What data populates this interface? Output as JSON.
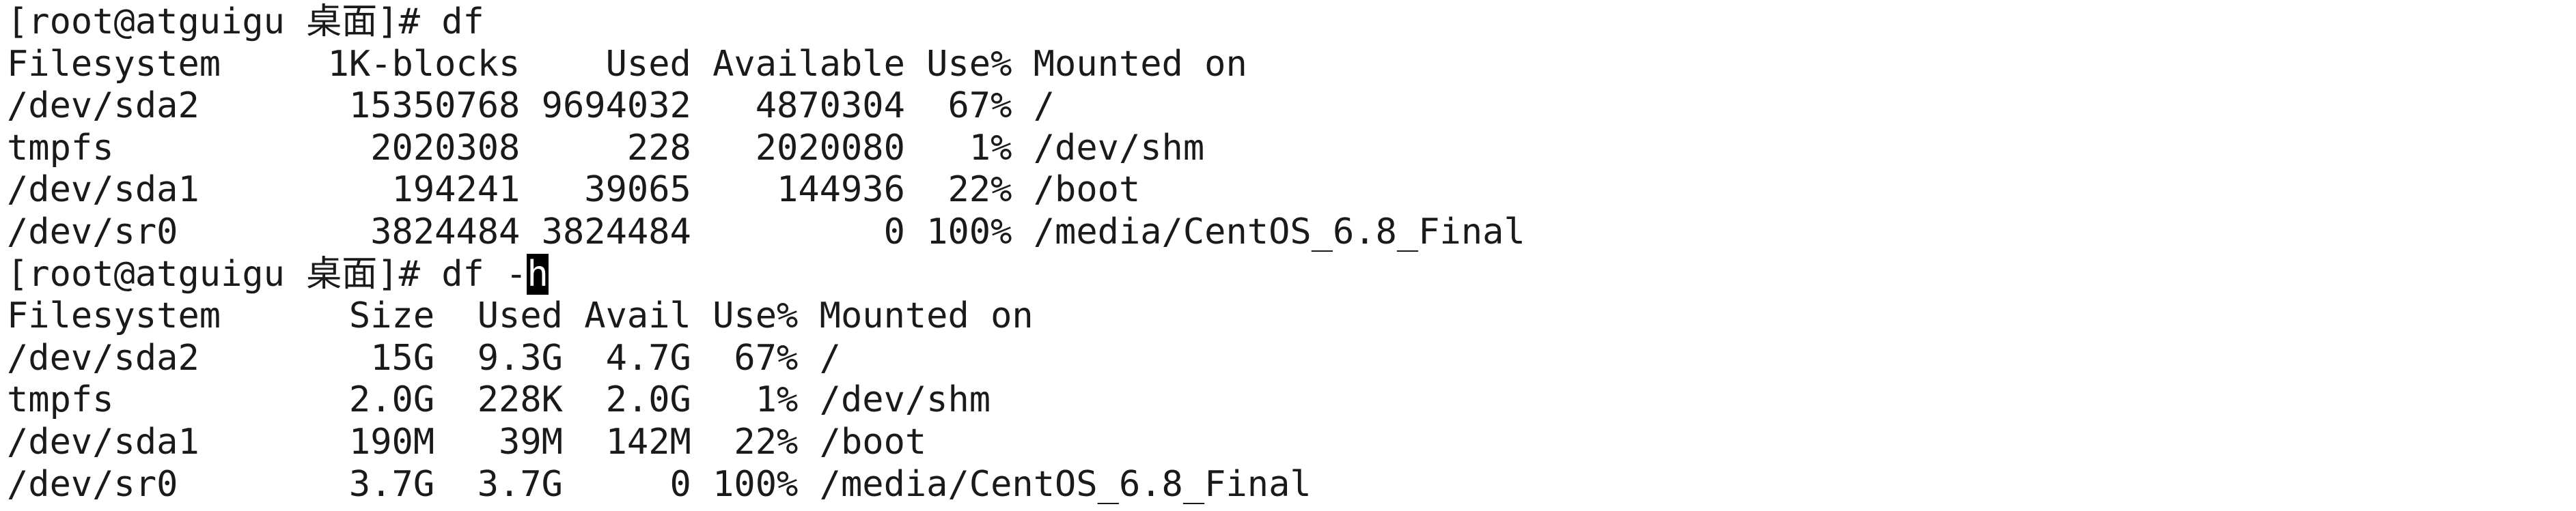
{
  "terminal": {
    "lines": [
      {
        "text": "[root@atguigu 桌面]# df"
      },
      {
        "text": "Filesystem     1K-blocks    Used Available Use% Mounted on"
      },
      {
        "text": "/dev/sda2       15350768 9694032   4870304  67% /"
      },
      {
        "text": "tmpfs            2020308     228   2020080   1% /dev/shm"
      },
      {
        "text": "/dev/sda1         194241   39065    144936  22% /boot"
      },
      {
        "text": "/dev/sr0         3824484 3824484         0 100% /media/CentOS_6.8_Final"
      },
      {
        "prefix": "[root@atguigu 桌面]# df -",
        "cursor_char": "h"
      },
      {
        "text": "Filesystem      Size  Used Avail Use% Mounted on"
      },
      {
        "text": "/dev/sda2        15G  9.3G  4.7G  67% /"
      },
      {
        "text": "tmpfs           2.0G  228K  2.0G   1% /dev/shm"
      },
      {
        "text": "/dev/sda1       190M   39M  142M  22% /boot"
      },
      {
        "text": "/dev/sr0        3.7G  3.7G     0 100% /media/CentOS_6.8_Final"
      }
    ]
  },
  "colors": {
    "background": "#ffffff",
    "foreground": "#1a1a1a",
    "cursor_bg": "#000000",
    "cursor_fg": "#ffffff"
  }
}
